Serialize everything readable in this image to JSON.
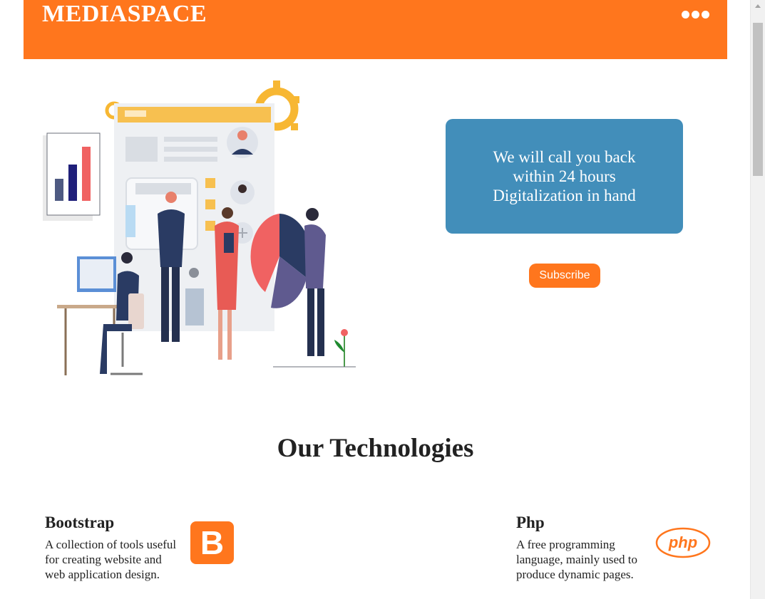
{
  "header": {
    "brand": "MEDIASPACE",
    "menu_icon": "more-dots-icon",
    "color": "#ff761d"
  },
  "hero": {
    "illustration": "business-team-illustration",
    "callback_lines": [
      "We will call you back",
      "within 24 hours",
      "Digitalization in hand"
    ],
    "callback_color": "#428eba",
    "subscribe_label": "Subscribe"
  },
  "technologies": {
    "title": "Our Technologies",
    "items": [
      {
        "name": "Bootstrap",
        "description": "A collection of tools useful for creating website and web application design.",
        "icon": "bootstrap-logo-icon",
        "logo_text": "B"
      },
      {
        "name": "Php",
        "description": "A free programming language, mainly used to produce dynamic pages.",
        "icon": "php-logo-icon",
        "logo_text": "php"
      }
    ]
  }
}
